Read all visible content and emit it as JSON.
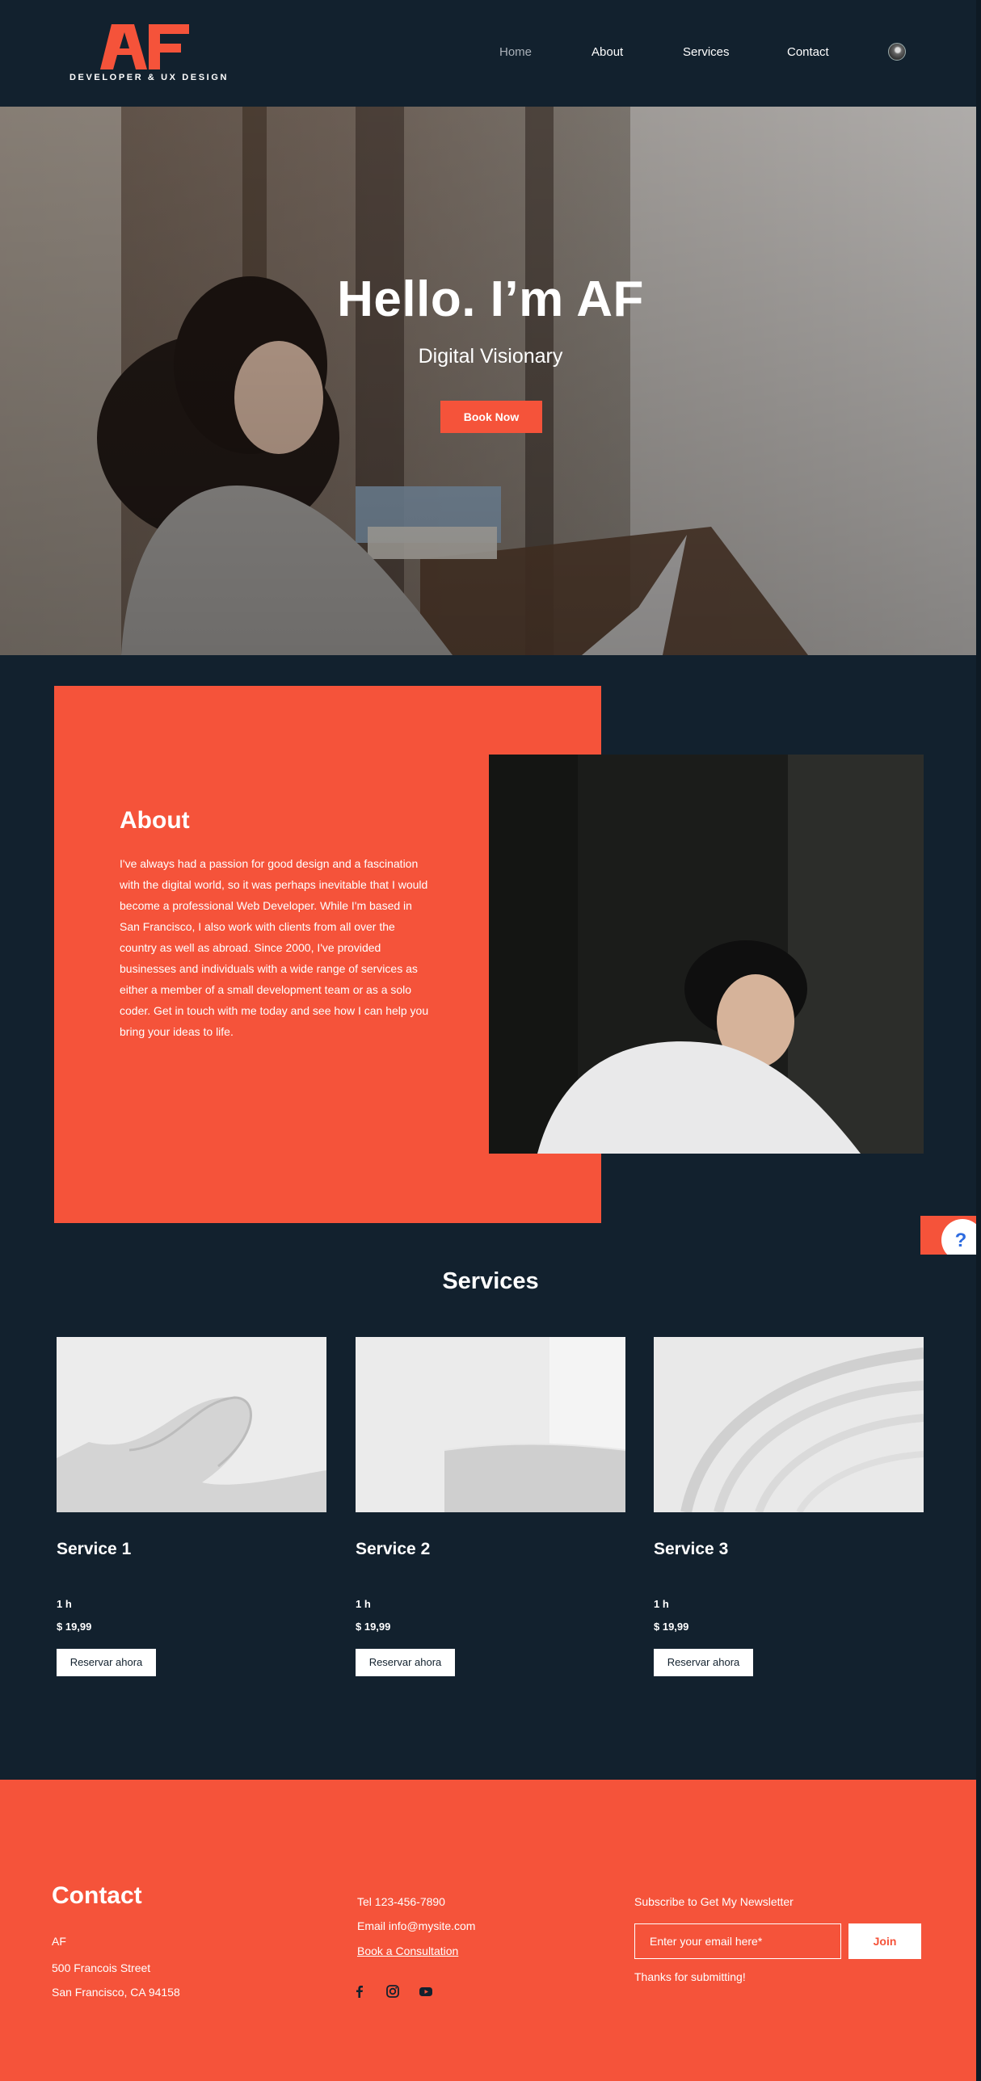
{
  "brand": {
    "logo_text": "AF",
    "tagline": "DEVELOPER & UX DESIGN",
    "accent_color": "#f5533a",
    "dark_color": "#12212e"
  },
  "nav": {
    "items": [
      {
        "label": "Home",
        "active": true
      },
      {
        "label": "About",
        "active": false
      },
      {
        "label": "Services",
        "active": false
      },
      {
        "label": "Contact",
        "active": false
      }
    ],
    "account_icon": "user-avatar-icon"
  },
  "hero": {
    "title": "Hello. I’m AF",
    "subtitle": "Digital Visionary",
    "cta_label": "Book Now"
  },
  "about": {
    "title": "About",
    "body": "I've always had a passion for good design and a fascination with the digital world, so it was perhaps inevitable that I would become a professional Web Developer. While I'm based in San Francisco, I also work with clients from all over the country as well as abroad. Since 2000, I've provided businesses and individuals with a wide range of services as either a member of a small development team or as a solo coder. Get in touch with me today and see how I can help you bring your ideas to life."
  },
  "services": {
    "title": "Services",
    "items": [
      {
        "name": "Service 1",
        "duration": "1 h",
        "price": "$ 19,99",
        "button": "Reservar ahora"
      },
      {
        "name": "Service 2",
        "duration": "1 h",
        "price": "$ 19,99",
        "button": "Reservar ahora"
      },
      {
        "name": "Service 3",
        "duration": "1 h",
        "price": "$ 19,99",
        "button": "Reservar ahora"
      }
    ]
  },
  "footer": {
    "contact_title": "Contact",
    "name": "AF",
    "address_line1": "500 Francois Street",
    "address_line2": "San Francisco, CA 94158",
    "tel": "Tel 123-456-7890",
    "email": "Email info@mysite.com",
    "consultation_link": "Book a Consultation",
    "social_icons": [
      "facebook-icon",
      "instagram-icon",
      "youtube-icon"
    ],
    "newsletter_label": "Subscribe to Get My Newsletter",
    "email_placeholder": "Enter your email here*",
    "join_label": "Join",
    "thanks_text": "Thanks for submitting!"
  },
  "help_widget": {
    "icon": "help-chat-icon",
    "glyph": "?"
  }
}
